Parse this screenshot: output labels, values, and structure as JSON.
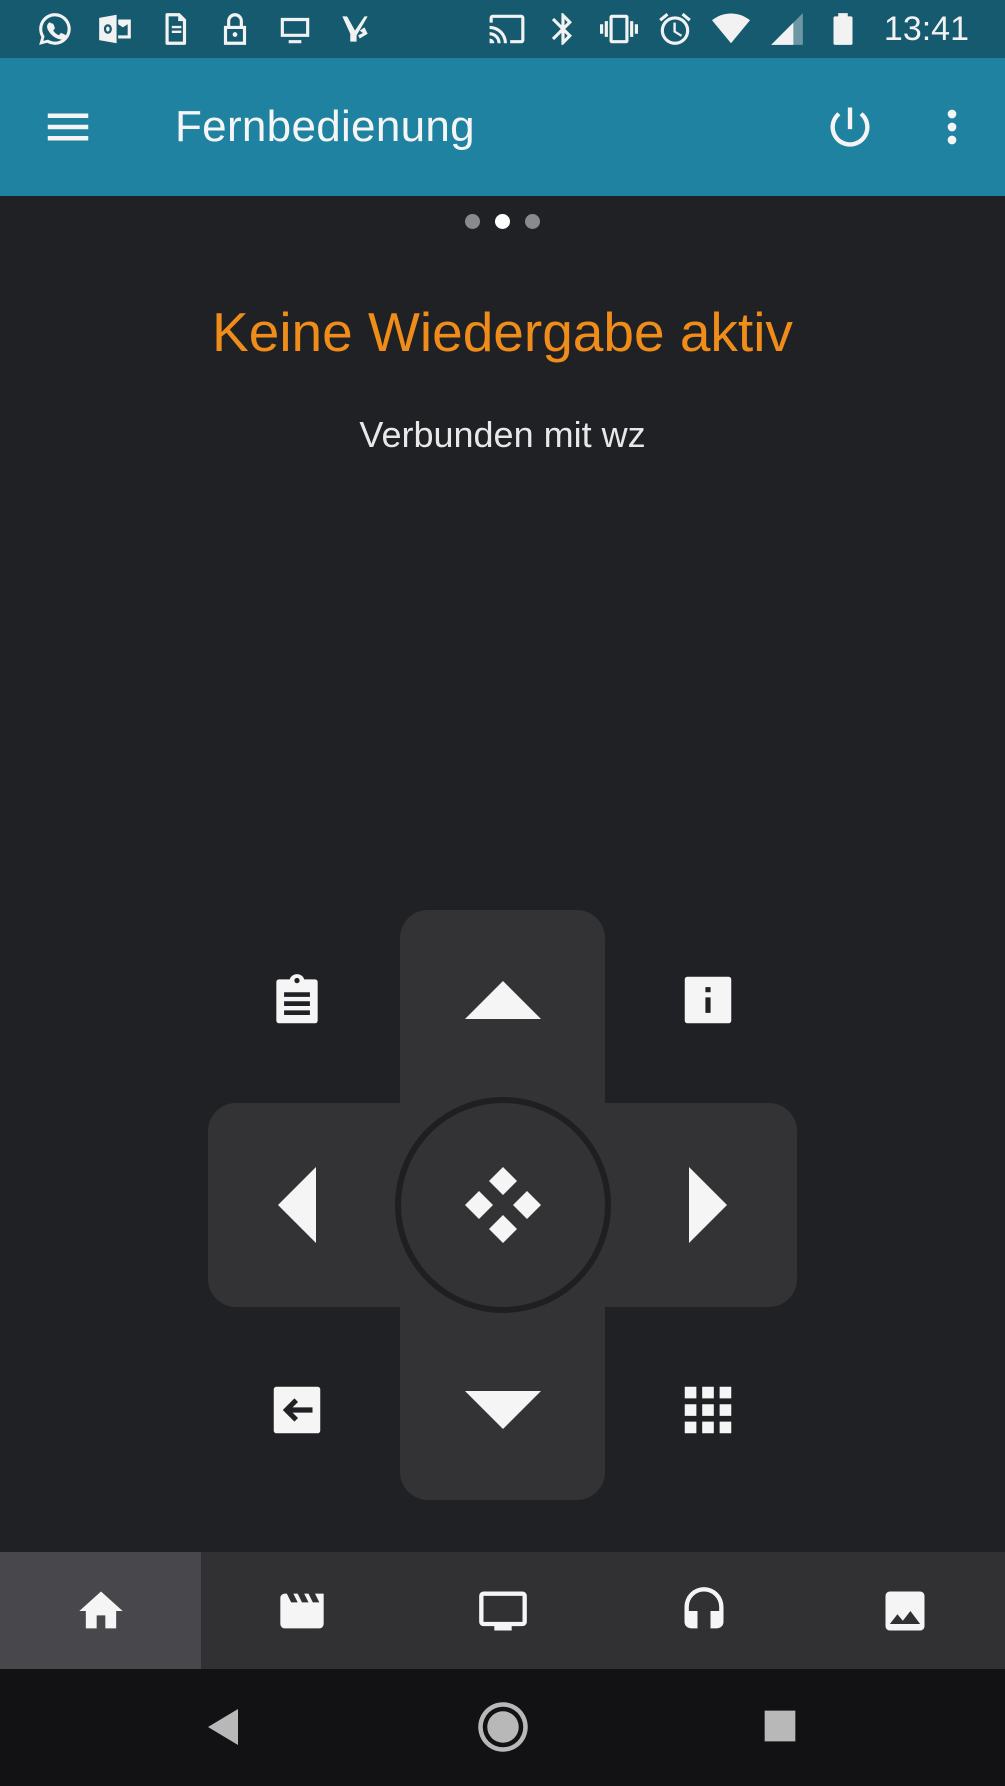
{
  "status_bar": {
    "left_icons": [
      "whatsapp-icon",
      "outlook-icon",
      "sim-transfer-icon",
      "lock-icon",
      "tv-icon",
      "inbox-check-icon"
    ],
    "right_icons": [
      "cast-icon",
      "bluetooth-icon",
      "vibrate-icon",
      "alarm-icon",
      "wifi-icon",
      "signal-icon",
      "battery-icon"
    ],
    "time": "13:41"
  },
  "app_bar": {
    "title": "Fernbedienung",
    "icons": [
      "menu-icon",
      "power-icon",
      "more-vert-icon"
    ]
  },
  "pager": {
    "count": 3,
    "active_index": 1
  },
  "now_playing": {
    "title": "Keine Wiedergabe aktiv",
    "subtitle": "Verbunden mit wz"
  },
  "remote": {
    "buttons": [
      "context-menu-icon",
      "up-arrow-icon",
      "info-icon",
      "left-arrow-icon",
      "select-icon",
      "right-arrow-icon",
      "back-icon",
      "down-arrow-icon",
      "home-grid-icon"
    ]
  },
  "bottom_tabs": {
    "items": [
      "home-icon",
      "movies-icon",
      "tv-icon",
      "music-icon",
      "pictures-icon"
    ],
    "active_index": 0
  },
  "colors": {
    "status_bar": "#155a6f",
    "app_bar": "#1e82a0",
    "background": "#202124",
    "accent": "#f08c1a",
    "pad": "#333235",
    "tab_bar": "#313033",
    "tab_active": "#48474b",
    "nav_bar": "#121214"
  },
  "nav_bar": {
    "icons": [
      "back-triangle-icon",
      "home-circle-icon",
      "recents-square-icon"
    ]
  }
}
